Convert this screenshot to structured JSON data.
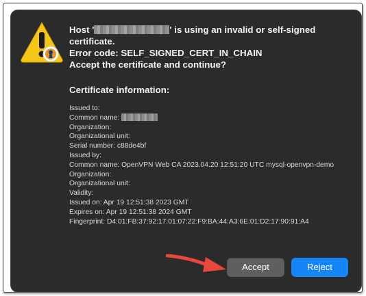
{
  "message": {
    "host_prefix": "Host '",
    "host_suffix": "' is using an invalid or self-signed",
    "line2": "certificate.",
    "line3": "Error code: SELF_SIGNED_CERT_IN_CHAIN",
    "line4": "Accept the certificate and continue?"
  },
  "certificate": {
    "title": "Certificate information:",
    "issued_to": "Issued to:",
    "common_name_label": "Common name: ",
    "organization": "Organization:",
    "organizational_unit": "Organizational unit:",
    "serial_number": "Serial number: c88de4bf",
    "issued_by": "Issued by:",
    "issuer_common_name": "Common name: OpenVPN Web CA 2023.04.20 12:51:20 UTC mysql-openvpn-demo",
    "issuer_organization": "Organization:",
    "issuer_organizational_unit": "Organizational unit:",
    "validity": "Validity:",
    "issued_on": "Issued on: Apr 19 12:51:38 2023 GMT",
    "expires_on": "Expires on: Apr 19 12:51:38 2024 GMT",
    "fingerprint": "Fingerprint: D4:01:FB:37:92:17:01:07:22:F9:BA:44:A3:6E:01:D2:17:90:91:A4"
  },
  "buttons": {
    "accept": "Accept",
    "reject": "Reject"
  },
  "icons": {
    "warning": "warning-triangle-icon",
    "arrow": "annotation-arrow-icon"
  },
  "colors": {
    "dialog_bg": "#2b2b2b",
    "accept_bg": "#5f5f5f",
    "reject_bg": "#1585f7",
    "arrow": "#e8473c",
    "warning": "#f5c518"
  }
}
